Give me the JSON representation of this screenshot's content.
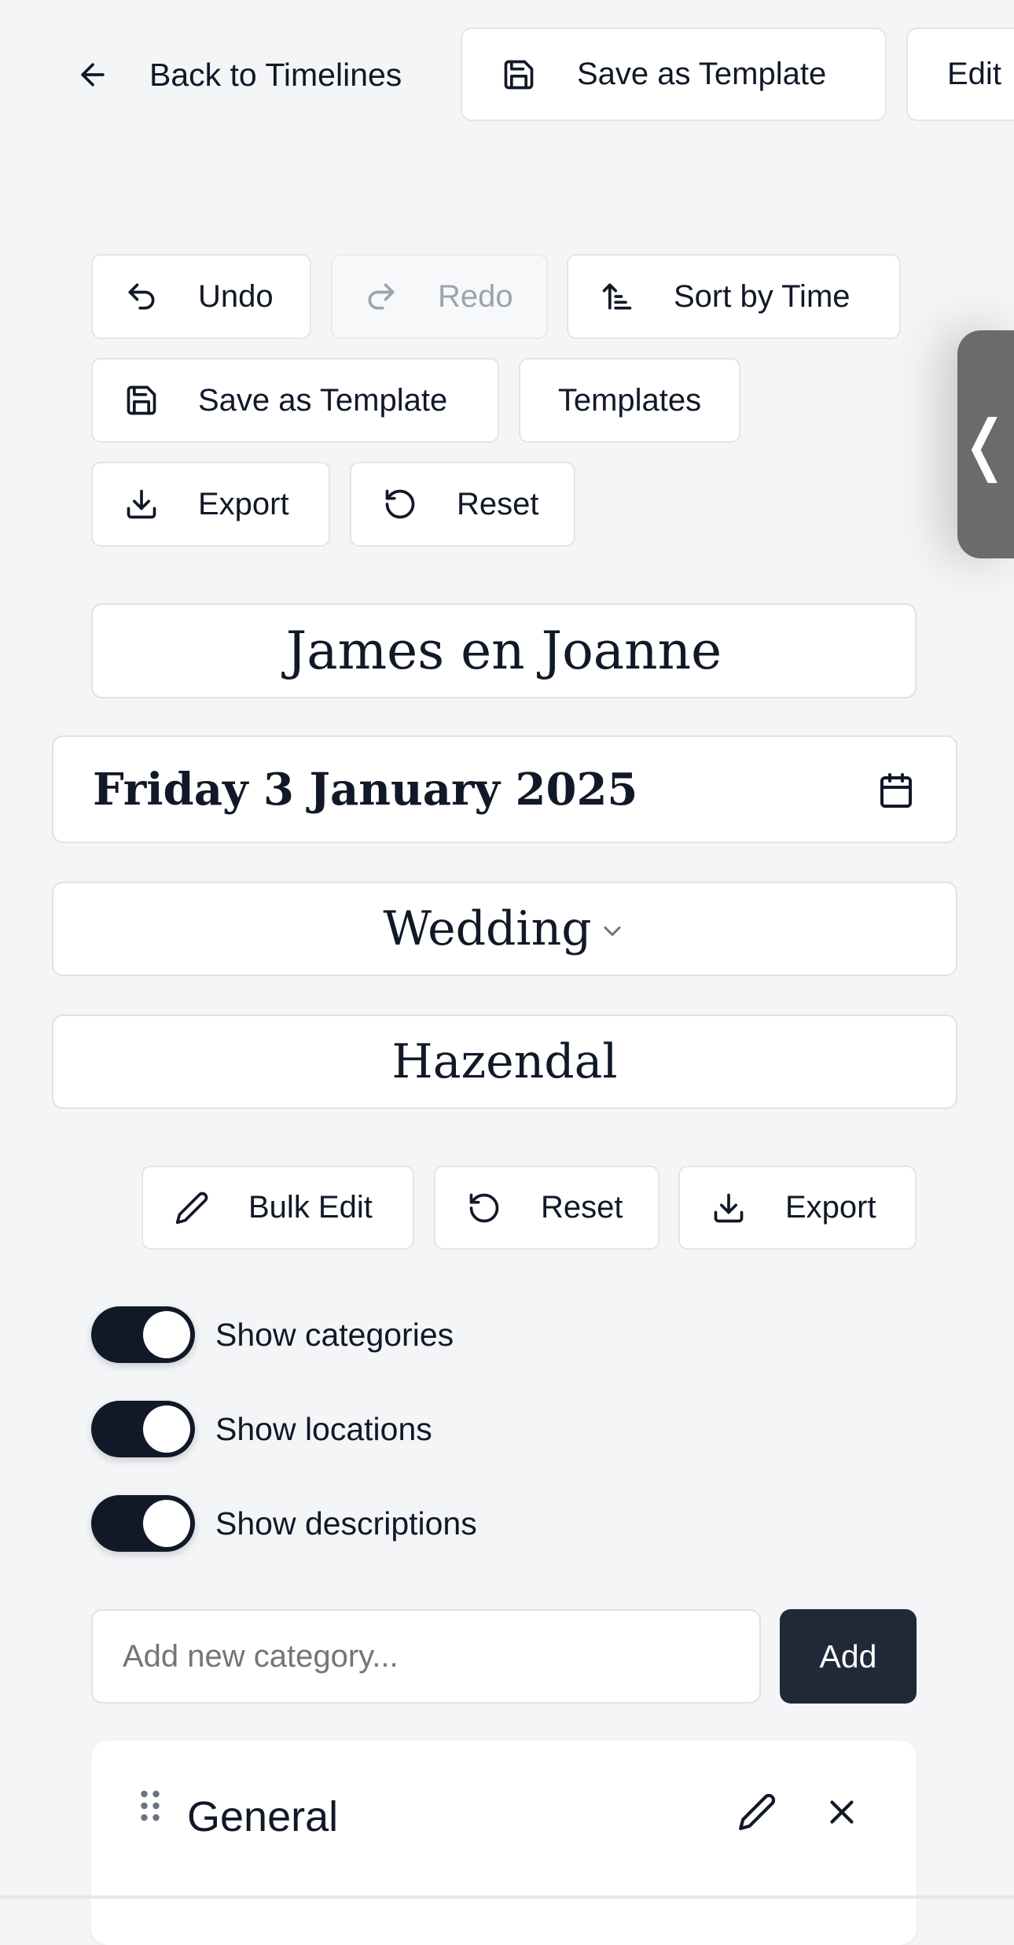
{
  "topbar": {
    "back_label": "Back to Timelines",
    "save_template_label": "Save as Template",
    "edit_label": "Edit"
  },
  "toolbar": {
    "undo": "Undo",
    "redo": "Redo",
    "sort_by_time": "Sort by Time",
    "save_as_template": "Save as Template",
    "templates": "Templates",
    "export": "Export",
    "reset": "Reset"
  },
  "event": {
    "names": "James en Joanne",
    "date": "Friday 3 January 2025",
    "type": "Wedding",
    "venue": "Hazendal"
  },
  "actions": {
    "bulk_edit": "Bulk Edit",
    "reset": "Reset",
    "export": "Export"
  },
  "toggles": [
    {
      "label": "Show categories",
      "on": true
    },
    {
      "label": "Show locations",
      "on": true
    },
    {
      "label": "Show descriptions",
      "on": true
    }
  ],
  "category_input": {
    "placeholder": "Add new category...",
    "value": "",
    "add_label": "Add"
  },
  "categories": [
    {
      "name": "General"
    }
  ],
  "side_handle": {
    "glyph": "❬"
  },
  "colors": {
    "background": "#f4f5f7",
    "primary": "#1f2937",
    "toggle_on": "#111827",
    "side_handle": "#6b6b6b"
  }
}
